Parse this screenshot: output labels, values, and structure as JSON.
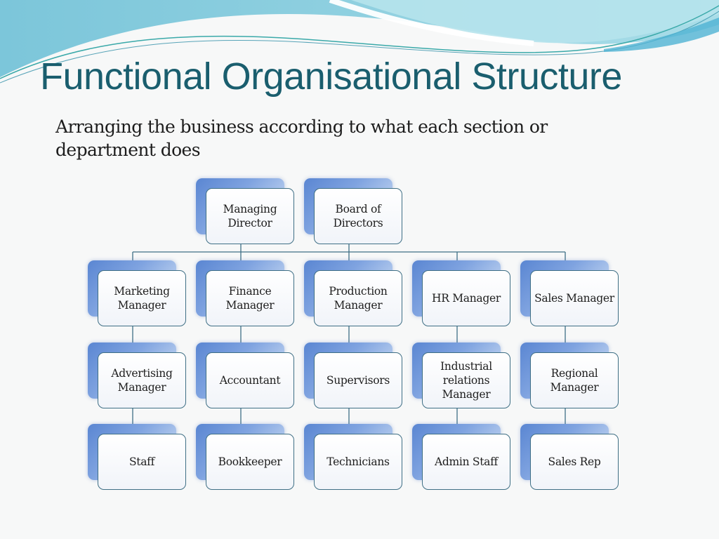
{
  "slide": {
    "title": "Functional Organisational Structure",
    "subtitle": "Arranging the business according to what each section or department does"
  },
  "colors": {
    "title": "#1a5e6e",
    "connector": "#3f6f85",
    "box_border": "#3f6f85",
    "box_shadow": "#5a86d2",
    "header_wave": "#6cc3d8"
  },
  "org_chart": {
    "top": [
      {
        "id": "managing-director",
        "label": "Managing Director"
      },
      {
        "id": "board-of-directors",
        "label": "Board of Directors"
      }
    ],
    "columns": [
      {
        "id": "marketing",
        "nodes": [
          "Marketing Manager",
          "Advertising Manager",
          "Staff"
        ]
      },
      {
        "id": "finance",
        "nodes": [
          "Finance Manager",
          "Accountant",
          "Bookkeeper"
        ]
      },
      {
        "id": "production",
        "nodes": [
          "Production Manager",
          "Supervisors",
          "Technicians"
        ]
      },
      {
        "id": "hr",
        "nodes": [
          "HR Manager",
          "Industrial relations Manager",
          "Admin Staff"
        ]
      },
      {
        "id": "sales",
        "nodes": [
          "Sales Manager",
          "Regional Manager",
          "Sales Rep"
        ]
      }
    ]
  }
}
